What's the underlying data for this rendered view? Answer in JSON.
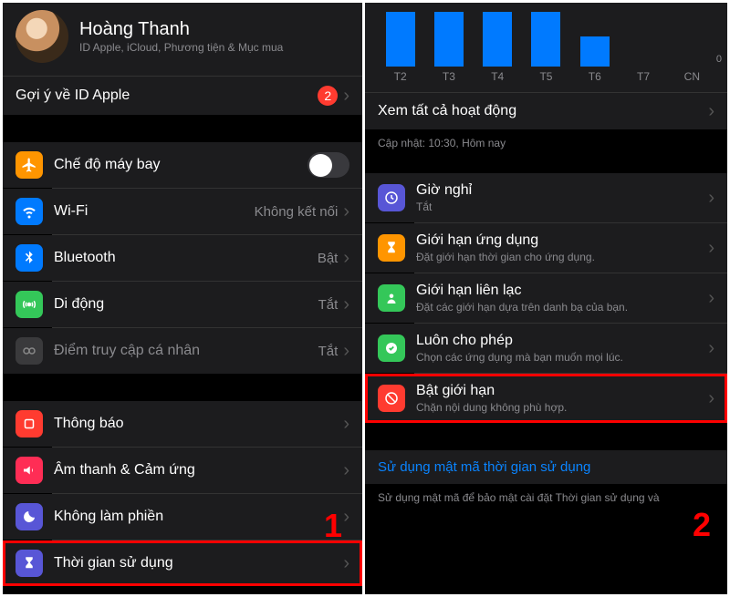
{
  "left": {
    "profile": {
      "name": "Hoàng Thanh",
      "sub": "ID Apple, iCloud, Phương tiện & Mục mua"
    },
    "suggestion": {
      "label": "Gợi ý về ID Apple",
      "badge": "2"
    },
    "airplane": {
      "label": "Chế độ máy bay"
    },
    "wifi": {
      "label": "Wi-Fi",
      "val": "Không kết nối"
    },
    "bluetooth": {
      "label": "Bluetooth",
      "val": "Bật"
    },
    "cellular": {
      "label": "Di động",
      "val": "Tắt"
    },
    "hotspot": {
      "label": "Điểm truy cập cá nhân",
      "val": "Tắt"
    },
    "notifications": {
      "label": "Thông báo"
    },
    "sounds": {
      "label": "Âm thanh & Cảm ứng"
    },
    "dnd": {
      "label": "Không làm phiền"
    },
    "screentime": {
      "label": "Thời gian sử dụng"
    }
  },
  "right": {
    "viewall": {
      "label": "Xem tất cả hoạt động"
    },
    "updated": "Cập nhật: 10:30, Hôm nay",
    "downtime": {
      "label": "Giờ nghỉ",
      "sub": "Tắt"
    },
    "applimits": {
      "label": "Giới hạn ứng dụng",
      "sub": "Đặt giới hạn thời gian cho ứng dụng."
    },
    "commlimits": {
      "label": "Giới hạn liên lạc",
      "sub": "Đặt các giới hạn dựa trên danh bạ của bạn."
    },
    "always": {
      "label": "Luôn cho phép",
      "sub": "Chọn các ứng dụng mà bạn muốn mọi lúc."
    },
    "restrict": {
      "label": "Bật giới hạn",
      "sub": "Chặn nội dung không phù hợp."
    },
    "passcode": "Sử dụng mật mã thời gian sử dụng",
    "passcodefoot": "Sử dụng mật mã để bảo mật cài đặt Thời gian sử dụng và",
    "axis": [
      "T2",
      "T3",
      "T4",
      "T5",
      "T6",
      "T7",
      "CN"
    ],
    "zero": "0"
  },
  "markers": {
    "m1": "1",
    "m2": "2"
  },
  "chart_data": {
    "type": "bar",
    "categories": [
      "T2",
      "T3",
      "T4",
      "T5",
      "T6",
      "T7",
      "CN"
    ],
    "values": [
      60,
      60,
      60,
      60,
      33,
      0,
      0
    ],
    "title": "",
    "xlabel": "",
    "ylabel": "",
    "ylim": [
      0,
      60
    ]
  }
}
